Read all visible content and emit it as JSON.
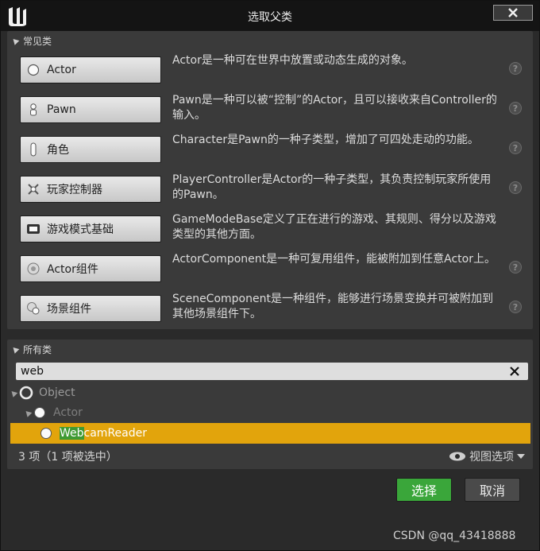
{
  "window": {
    "title": "选取父类"
  },
  "common": {
    "header": "常见类",
    "items": [
      {
        "label": "Actor",
        "icon": "sphere-icon",
        "desc": "Actor是一种可在世界中放置或动态生成的对象。"
      },
      {
        "label": "Pawn",
        "icon": "pawn-icon",
        "desc": "Pawn是一种可以被“控制”的Actor，且可以接收来自Controller的输入。"
      },
      {
        "label": "角色",
        "icon": "character-icon",
        "desc": "Character是Pawn的一种子类型，增加了可四处走动的功能。"
      },
      {
        "label": "玩家控制器",
        "icon": "player-controller-icon",
        "desc": "PlayerController是Actor的一种子类型，其负责控制玩家所使用的Pawn。"
      },
      {
        "label": "游戏模式基础",
        "icon": "game-mode-icon",
        "desc": "GameModeBase定义了正在进行的游戏、其规则、得分以及游戏类型的其他方面。"
      },
      {
        "label": "Actor组件",
        "icon": "actor-component-icon",
        "desc": "ActorComponent是一种可复用组件，能被附加到任意Actor上。"
      },
      {
        "label": "场景组件",
        "icon": "scene-component-icon",
        "desc": "SceneComponent是一种组件，能够进行场景变换并可被附加到其他场景组件下。"
      }
    ]
  },
  "all": {
    "header": "所有类",
    "search_value": "web",
    "tree": [
      {
        "label": "Object",
        "level": 0
      },
      {
        "label": "Actor",
        "level": 1
      },
      {
        "label_match": "Web",
        "label_rest": "camReader",
        "level": 2,
        "selected": true
      }
    ],
    "status": "3 项（1 项被选中）",
    "view_options": "视图选项"
  },
  "footer": {
    "select_label": "选择",
    "cancel_label": "取消"
  },
  "watermark": "CSDN @qq_43418888",
  "colors": {
    "selection": "#e2a40c",
    "match_highlight": "#3f9a33",
    "select_button": "#3aa63a"
  }
}
